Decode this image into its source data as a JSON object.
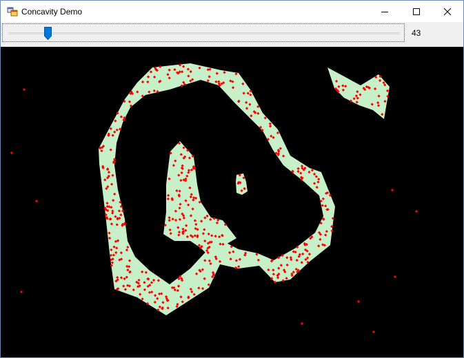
{
  "window": {
    "title": "Concavity Demo"
  },
  "controls": {
    "concavity_value": "43",
    "concavity_fraction": 0.1
  },
  "colors": {
    "hull_fill": "#c8f0c8",
    "point_color": "#ff0000",
    "canvas_background": "#000000",
    "slider_thumb": "#0078d7"
  },
  "icons": {
    "app": "app-window-icon",
    "minimize": "minimize-icon",
    "maximize": "maximize-icon",
    "close": "close-icon"
  }
}
